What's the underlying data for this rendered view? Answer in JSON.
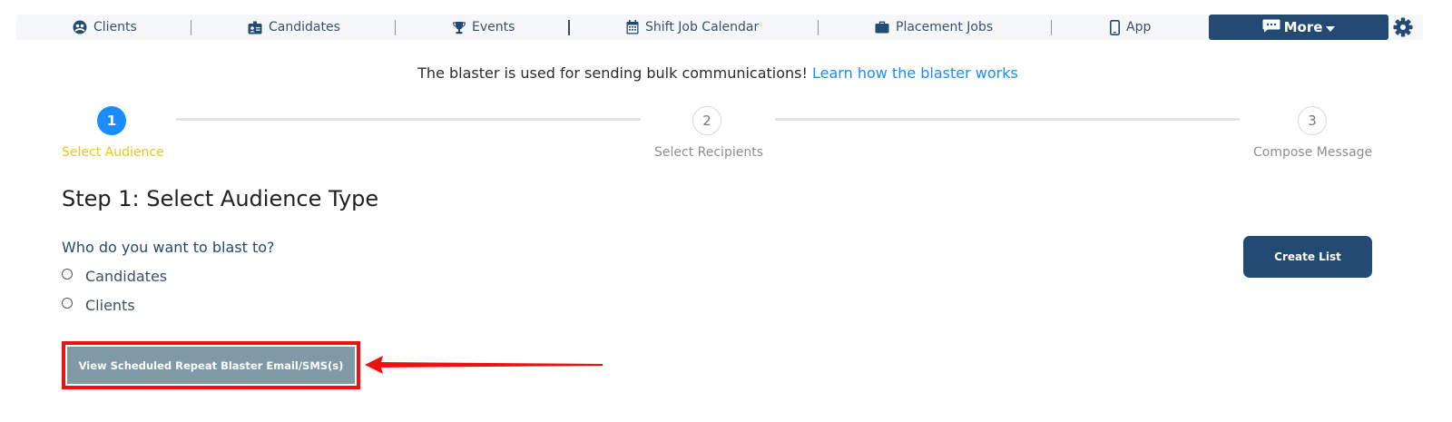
{
  "nav": {
    "items": [
      {
        "label": "Clients",
        "icon": "clients-icon"
      },
      {
        "label": "Candidates",
        "icon": "candidates-icon"
      },
      {
        "label": "Events",
        "icon": "trophy-icon"
      },
      {
        "label": "Shift Job Calendar",
        "icon": "calendar-icon"
      },
      {
        "label": "Placement Jobs",
        "icon": "briefcase-icon"
      },
      {
        "label": "App",
        "icon": "phone-icon"
      }
    ],
    "more_label": "More",
    "more_icon": "chat-bubble-icon",
    "settings_icon": "gear-icon"
  },
  "info": {
    "text": "The blaster is used for sending bulk communications!",
    "link": "Learn how the blaster works"
  },
  "stepper": {
    "steps": [
      {
        "number": "1",
        "label": "Select Audience",
        "state": "active"
      },
      {
        "number": "2",
        "label": "Select Recipients",
        "state": "todo"
      },
      {
        "number": "3",
        "label": "Compose Message",
        "state": "todo"
      }
    ],
    "active_color": "#1a8cff",
    "active_label_color": "#f0c419"
  },
  "main": {
    "title": "Step 1: Select Audience Type",
    "question": "Who do you want to blast to?",
    "options": [
      {
        "label": "Candidates",
        "selected": false
      },
      {
        "label": "Clients",
        "selected": false
      }
    ],
    "create_list_label": "Create List",
    "scheduled_label": "View Scheduled Repeat Blaster Email/SMS(s)"
  },
  "colors": {
    "primary": "#234a72",
    "link": "#1a8cff",
    "annotation_red": "#ee1111",
    "scheduled_button": "#7f9aa4"
  }
}
